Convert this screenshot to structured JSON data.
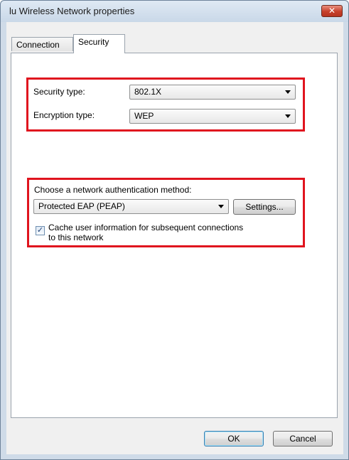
{
  "window": {
    "title": "lu Wireless Network properties",
    "close_glyph": "✕"
  },
  "tabs": [
    {
      "label": "Connection",
      "selected": false
    },
    {
      "label": "Security",
      "selected": true
    }
  ],
  "security": {
    "security_type_label": "Security type:",
    "security_type_value": "802.1X",
    "encryption_type_label": "Encryption type:",
    "encryption_type_value": "WEP"
  },
  "auth": {
    "method_label": "Choose a network authentication method:",
    "method_value": "Protected EAP (PEAP)",
    "settings_label": "Settings...",
    "cache_checked": true,
    "cache_check_glyph": "✓",
    "cache_label_line1": "Cache user information for subsequent connections",
    "cache_label_line2": "to this network"
  },
  "footer": {
    "ok_label": "OK",
    "cancel_label": "Cancel"
  },
  "colors": {
    "highlight_border": "#e0141e",
    "window_frame": "#cfdbe8"
  },
  "icons": {
    "close": "close-icon",
    "dropdown": "chevron-down-icon",
    "check": "check-icon"
  }
}
